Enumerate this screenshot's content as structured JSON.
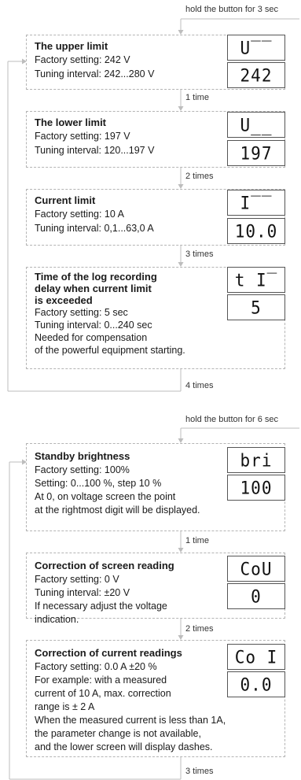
{
  "header_top": "hold the button for 3 sec",
  "header_mid": "hold the button for 6 sec",
  "blocks": [
    {
      "title": "The upper limit",
      "lines": [
        "Factory setting: 242 V",
        "Tuning interval: 242...280 V"
      ],
      "display_top": "U‾‾",
      "display_bottom": "242",
      "after": "1 time"
    },
    {
      "title": "The lower limit",
      "lines": [
        "Factory setting: 197 V",
        "Tuning interval: 120...197 V"
      ],
      "display_top": "U__",
      "display_bottom": "197",
      "after": "2 times"
    },
    {
      "title": "Current limit",
      "lines": [
        "Factory setting: 10 A",
        "Tuning interval: 0,1...63,0 A"
      ],
      "display_top": "I‾‾",
      "display_bottom": "10.0",
      "after": "3 times"
    },
    {
      "title_lines": [
        "Time of the log recording",
        "delay when current limit",
        "is exceeded"
      ],
      "lines": [
        "Factory setting: 5 sec",
        "Tuning interval: 0...240 sec",
        "Needed for compensation",
        "of the powerful equipment starting."
      ],
      "display_top": "t I‾",
      "display_bottom": "5",
      "after": "4 times"
    },
    {
      "title": "Standby brightness",
      "lines": [
        "Factory setting: 100%",
        "Setting: 0...100 %, step 10 %",
        "At 0, on voltage screen the point",
        "at the rightmost digit will be displayed."
      ],
      "display_top": "bri",
      "display_bottom": "100",
      "after": "1 time"
    },
    {
      "title": "Correction of screen reading",
      "lines": [
        "Factory setting: 0 V",
        "Tuning interval: ±20 V",
        "If necessary adjust the voltage",
        "indication."
      ],
      "display_top": "CoU",
      "display_bottom": "0",
      "after": "2 times"
    },
    {
      "title": "Correction of current readings",
      "lines": [
        "Factory setting: 0.0 A ±20 %",
        "For example: with a measured",
        "current of 10 A, max. correction",
        "range is ± 2 A",
        "When the measured current is less than 1A,",
        "the parameter change is not available,",
        "and the lower screen will display dashes."
      ],
      "display_top": "Co I",
      "display_bottom": "0.0",
      "after": "3 times"
    }
  ]
}
